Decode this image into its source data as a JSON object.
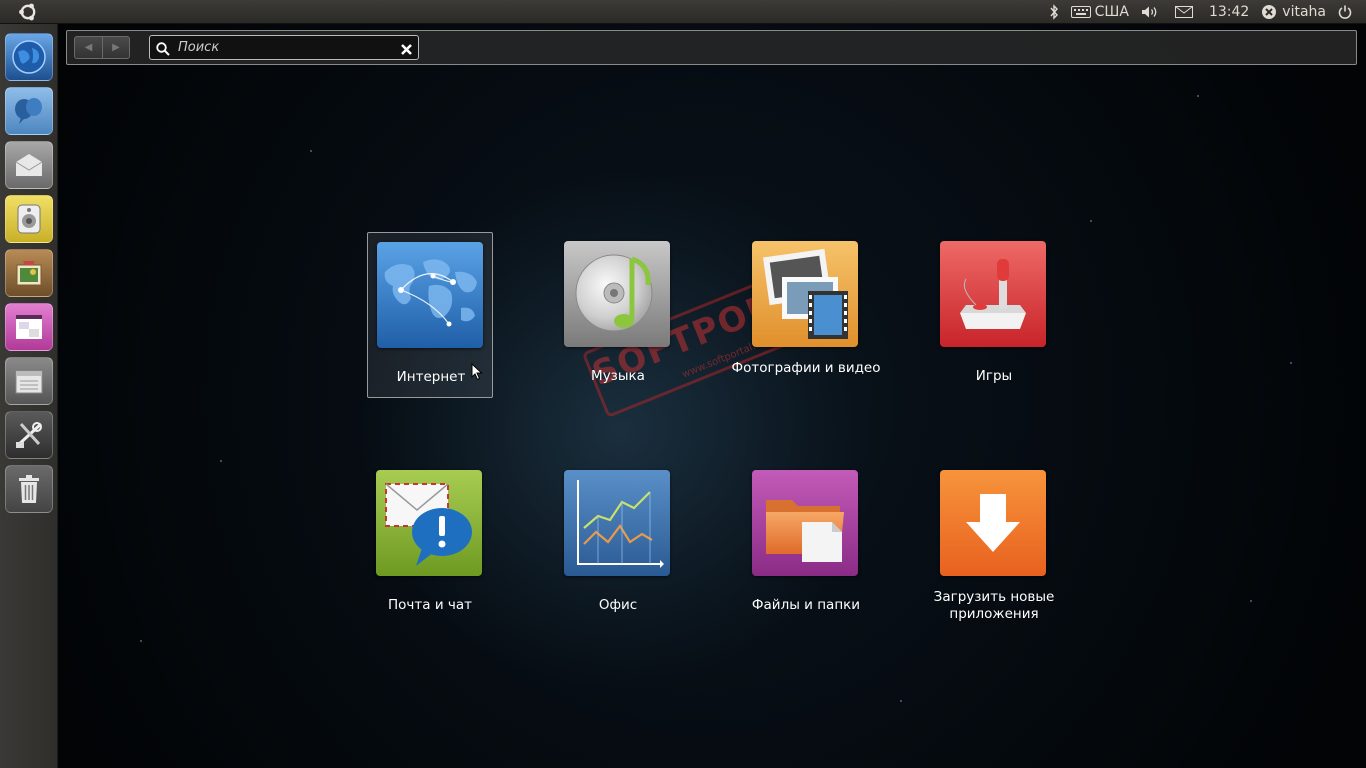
{
  "top_panel": {
    "keyboard_layout": "США",
    "clock": "13:42",
    "user_name": "vitaha",
    "icons": [
      "ubuntu-logo-icon",
      "bluetooth-icon",
      "keyboard-icon",
      "volume-icon",
      "mail-icon",
      "user-status-icon",
      "power-icon"
    ]
  },
  "launcher": {
    "items": [
      {
        "name": "firefox",
        "icon": "globe-icon",
        "color": "#2e6bb0"
      },
      {
        "name": "empathy",
        "icon": "chat-bubbles-icon",
        "color": "#5a8fc7"
      },
      {
        "name": "evolution",
        "icon": "envelope-icon",
        "color": "#8c8c8c"
      },
      {
        "name": "rhythmbox",
        "icon": "speaker-icon",
        "color": "#d9c33b"
      },
      {
        "name": "shotwell",
        "icon": "photo-icon",
        "color": "#8a6a3a"
      },
      {
        "name": "libreoffice",
        "icon": "office-icon",
        "color": "#c64aa8"
      },
      {
        "name": "files",
        "icon": "file-cabinet-icon",
        "color": "#6e6e6e"
      },
      {
        "name": "software-center",
        "icon": "tools-icon",
        "color": "#4a4a4a"
      },
      {
        "name": "trash",
        "icon": "trash-icon",
        "color": "#5a5a5a"
      }
    ]
  },
  "dash": {
    "search_placeholder": "Поиск",
    "search_value": ""
  },
  "categories": [
    {
      "label": "Интернет",
      "icon": "world-map-icon",
      "color": "#3a82c8",
      "selected": true
    },
    {
      "label": "Музыка",
      "icon": "music-cd-icon",
      "color": "#9a9a9a",
      "selected": false
    },
    {
      "label": "Фотографии и видео",
      "icon": "photos-film-icon",
      "color": "#e8a848",
      "selected": false
    },
    {
      "label": "Игры",
      "icon": "joystick-icon",
      "color": "#d8393c",
      "selected": false
    },
    {
      "label": "Почта и чат",
      "icon": "mail-chat-icon",
      "color": "#8cb83a",
      "selected": false
    },
    {
      "label": "Офис",
      "icon": "chart-icon",
      "color": "#3a6ea8",
      "selected": false
    },
    {
      "label": "Файлы и папки",
      "icon": "folder-icon",
      "color": "#a83ca0",
      "selected": false
    },
    {
      "label": "Загрузить новые приложения",
      "icon": "download-arrow-icon",
      "color": "#f07a2a",
      "selected": false
    }
  ],
  "watermark": {
    "text": "SOFTPORTAL",
    "url": "www.softportal.com"
  }
}
